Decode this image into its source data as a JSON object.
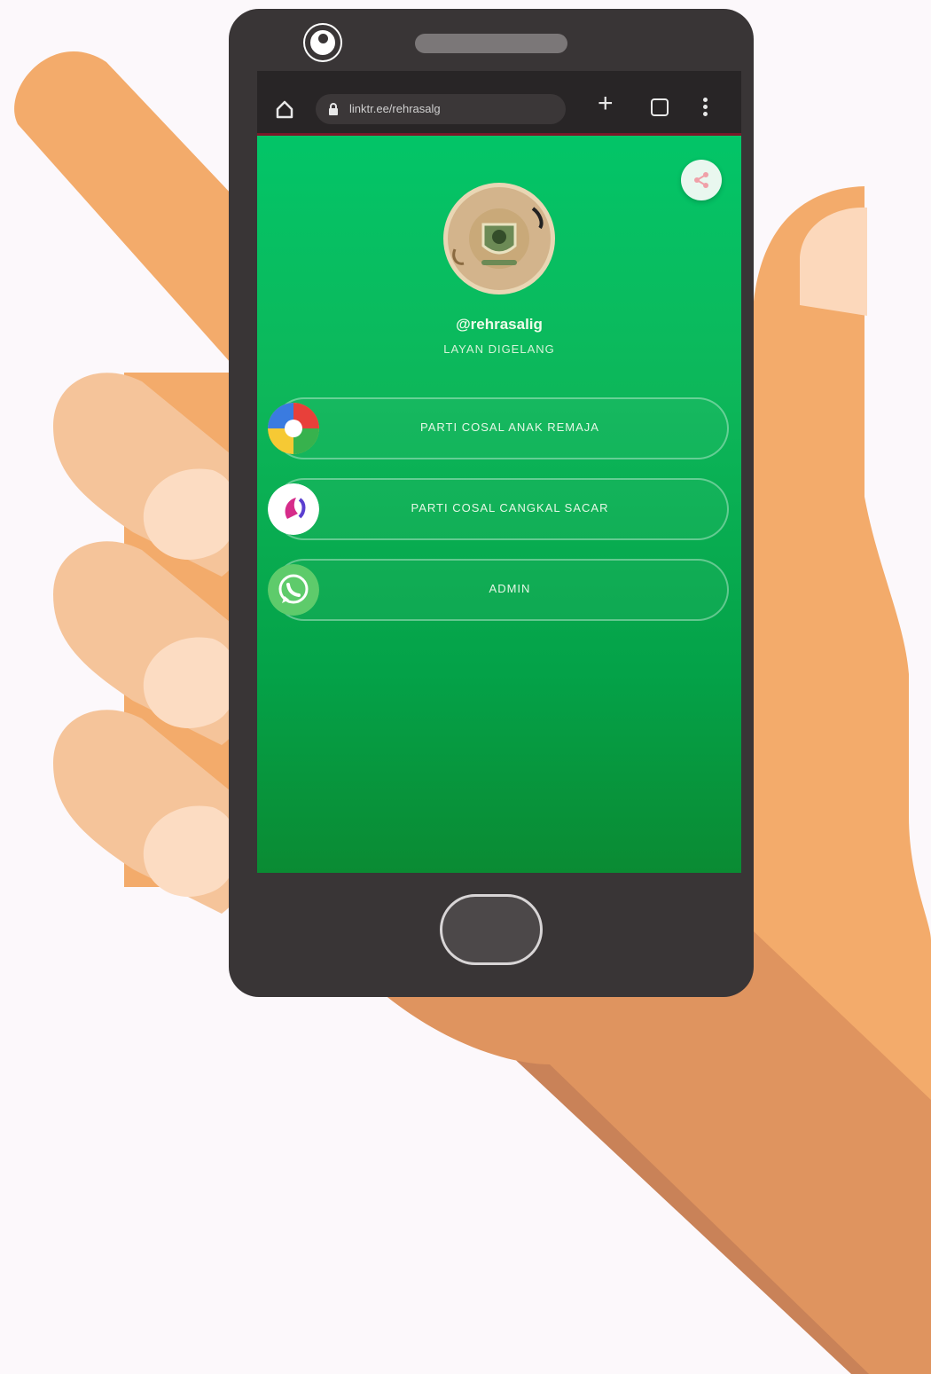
{
  "browser": {
    "url": "linktr.ee/rehrasalg"
  },
  "profile": {
    "name": "@rehrasalig",
    "subtitle": "LAYAN DIGELANG"
  },
  "links": [
    {
      "label": "PARTI COSAL ANAK REMAJA",
      "icon": "colorful-ball-icon"
    },
    {
      "label": "PARTI COSAL CANGKAL SACAR",
      "icon": "butterfly-logo-icon"
    },
    {
      "label": "ADMIN",
      "icon": "whatsapp-icon"
    }
  ],
  "colors": {
    "screen_top": "#00c86b",
    "screen_bottom": "#0a8b33",
    "phone_body": "#393536",
    "hand": "#f3ab6b",
    "background": "#fcf8fb"
  }
}
